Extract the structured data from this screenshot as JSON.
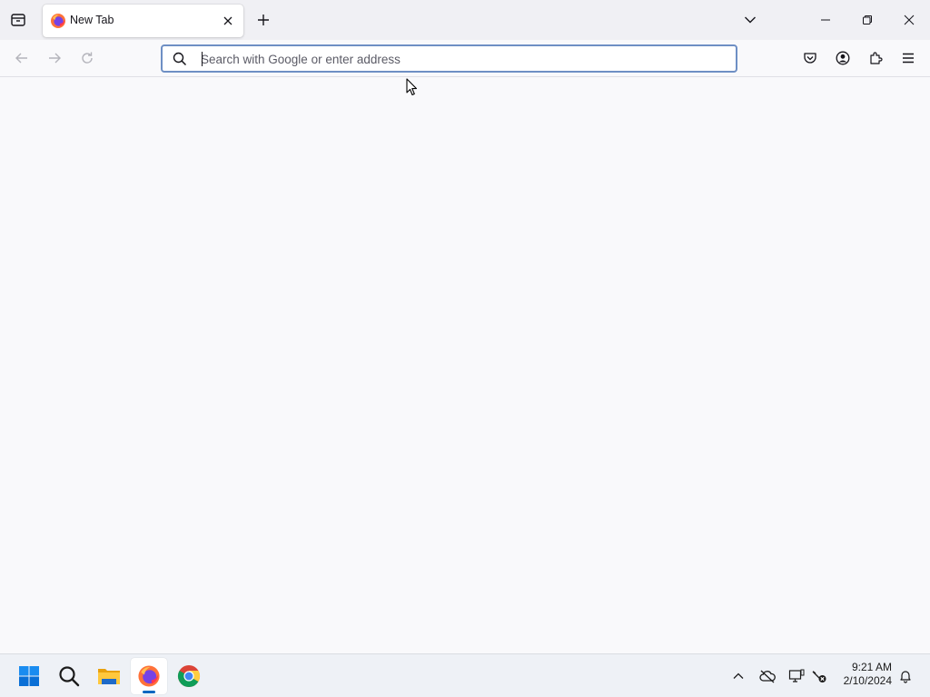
{
  "browser": {
    "tabs": [
      {
        "title": "New Tab",
        "favicon": "firefox-icon",
        "active": true
      }
    ],
    "window_controls": [
      "minimize-icon",
      "restore-icon",
      "close-icon"
    ],
    "urlbar": {
      "value": "",
      "placeholder": "Search with Google or enter address"
    },
    "toolbar_icons": [
      "pocket-icon",
      "account-icon",
      "extensions-icon",
      "menu-icon"
    ]
  },
  "taskbar": {
    "pinned_apps": [
      "windows-start",
      "search",
      "file-explorer",
      "firefox",
      "chrome"
    ],
    "active_app": "firefox",
    "tray_icons": [
      "show-hidden-icons",
      "onedrive-offline",
      "display",
      "network-disconnected"
    ],
    "clock": {
      "time": "9:21 AM",
      "date": "2/10/2024"
    }
  },
  "colors": {
    "tabstrip_bg": "#f0f0f4",
    "toolbar_bg": "#f9f9fb",
    "urlbar_focus_border": "#6e8fc4",
    "taskbar_bg": "#eef1f6",
    "taskbar_active_indicator": "#0067c0"
  }
}
